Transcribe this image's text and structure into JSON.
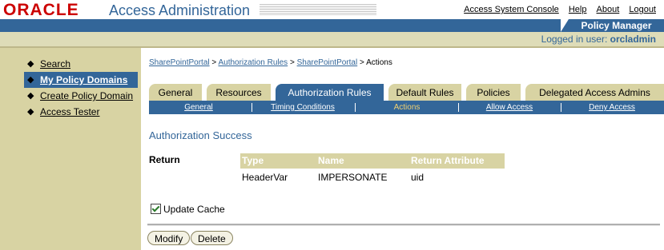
{
  "header": {
    "logo_text": "ORACLE",
    "app_title": "Access Administration",
    "links": [
      "Access System Console",
      "Help",
      "About",
      "Logout"
    ],
    "tab_label": "Policy Manager",
    "logged_prefix": "Logged in user:",
    "logged_user": "orcladmin"
  },
  "sidebar": {
    "items": [
      {
        "label": "Search"
      },
      {
        "label": "My Policy Domains"
      },
      {
        "label": "Create Policy Domain"
      },
      {
        "label": "Access Tester"
      }
    ]
  },
  "breadcrumb": {
    "items": [
      "SharePointPortal",
      "Authorization Rules",
      "SharePointPortal"
    ],
    "separator": ">",
    "current": "Actions"
  },
  "tabs": [
    "General",
    "Resources",
    "Authorization Rules",
    "Default Rules",
    "Policies",
    "Delegated Access Admins"
  ],
  "active_tab": "Authorization Rules",
  "subnav": [
    "General",
    "Timing Conditions",
    "Actions",
    "Allow Access",
    "Deny Access"
  ],
  "active_subnav": "Actions",
  "section_title": "Authorization Success",
  "return_label": "Return",
  "return_table": {
    "headers": [
      "Type",
      "Name",
      "Return Attribute"
    ],
    "rows": [
      [
        "HeaderVar",
        "IMPERSONATE",
        "uid"
      ]
    ]
  },
  "update_cache": {
    "label": "Update Cache",
    "checked": true
  },
  "buttons": {
    "modify": "Modify",
    "delete": "Delete"
  }
}
